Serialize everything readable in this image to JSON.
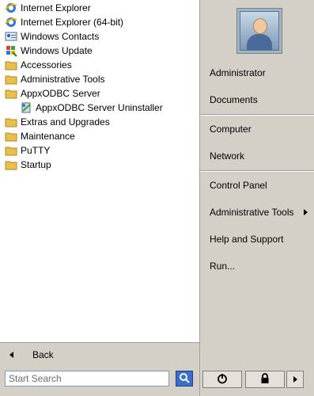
{
  "programs": [
    {
      "label": "Internet Explorer",
      "icon": "internet-explorer-icon",
      "sub": false
    },
    {
      "label": "Internet Explorer (64-bit)",
      "icon": "internet-explorer-icon",
      "sub": false
    },
    {
      "label": "Windows Contacts",
      "icon": "contacts-icon",
      "sub": false
    },
    {
      "label": "Windows Update",
      "icon": "windows-update-icon",
      "sub": false
    },
    {
      "label": "Accessories",
      "icon": "folder-icon",
      "sub": false
    },
    {
      "label": "Administrative Tools",
      "icon": "folder-icon",
      "sub": false
    },
    {
      "label": "AppxODBC Server",
      "icon": "folder-icon",
      "sub": false
    },
    {
      "label": "AppxODBC Server Uninstaller",
      "icon": "uninstaller-icon",
      "sub": true
    },
    {
      "label": "Extras and Upgrades",
      "icon": "folder-icon",
      "sub": false
    },
    {
      "label": "Maintenance",
      "icon": "folder-icon",
      "sub": false
    },
    {
      "label": "PuTTY",
      "icon": "folder-icon",
      "sub": false
    },
    {
      "label": "Startup",
      "icon": "folder-icon",
      "sub": false
    }
  ],
  "back_label": "Back",
  "search": {
    "placeholder": "Start Search",
    "icon": "search-icon"
  },
  "right_items": [
    {
      "label": "Administrator"
    },
    {
      "label": "Documents"
    },
    {
      "label": "Computer"
    },
    {
      "label": "Network"
    },
    {
      "label": "Control Panel"
    },
    {
      "label": "Administrative Tools",
      "submenu": true
    },
    {
      "label": "Help and Support"
    },
    {
      "label": "Run..."
    }
  ],
  "power_buttons": [
    "power-icon",
    "lock-icon",
    "more-options-arrow-icon"
  ],
  "colors": {
    "panel": "#d4d0c8",
    "list_bg": "#ffffff",
    "folder": "#e8c050",
    "search_btn": "#3a6fc9"
  }
}
